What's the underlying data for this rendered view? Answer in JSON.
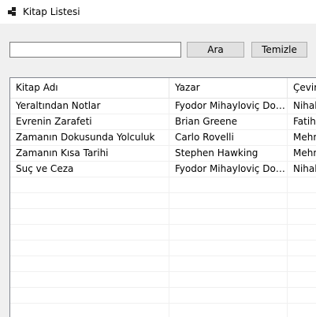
{
  "window": {
    "title": "Kitap Listesi",
    "icon": "window-app-icon"
  },
  "search": {
    "value": "",
    "placeholder": ""
  },
  "buttons": {
    "search_label": "Ara",
    "clear_label": "Temizle"
  },
  "table": {
    "columns": [
      "Kitap Adı",
      "Yazar",
      "Çevirmen"
    ],
    "rows": [
      [
        "Yeraltından Notlar",
        "Fyodor Mihayloviç Dostoyevski",
        "Nihal Yalaza Taluy"
      ],
      [
        "Evrenin Zarafeti",
        "Brian Greene",
        "Fatih Yılmaz"
      ],
      [
        "Zamanın Dokusunda Yolculuk",
        "Carlo Rovelli",
        "Mehmet"
      ],
      [
        "Zamanın Kısa Tarihi",
        "Stephen Hawking",
        "Mehmet"
      ],
      [
        "Suç ve Ceza",
        "Fyodor Mihayloviç Dostoyevski",
        "Nihal Yalaza Taluy"
      ]
    ]
  }
}
